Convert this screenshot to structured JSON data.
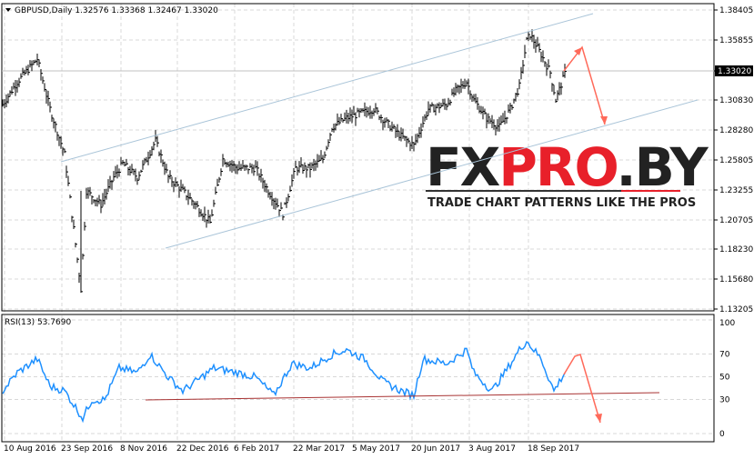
{
  "header": {
    "symbol": "GBPUSD,Daily",
    "open": "1.32576",
    "high": "1.33368",
    "low": "1.32467",
    "close": "1.33020"
  },
  "rsi_header": {
    "label": "RSI(13) 53.7690"
  },
  "current_price": "1.33020",
  "logo": {
    "brand": "FXPRO.BY",
    "tagline": "TRADE CHART PATTERNS LIKE THE PROS"
  },
  "colors": {
    "bars": "#000000",
    "rsi": "#1e90ff",
    "channel": "#a9c4d8",
    "rsi_trend": "#a83232",
    "arrows": "#ff6a5a"
  },
  "chart_data": [
    {
      "type": "line",
      "title": "GBPUSD,Daily",
      "ylim": [
        1.13205,
        1.38405
      ],
      "y_ticks": [
        "1.38405",
        "1.35855",
        "1.33020",
        "1.30830",
        "1.28280",
        "1.25805",
        "1.23255",
        "1.20705",
        "1.18230",
        "1.15680",
        "1.13205"
      ],
      "x_ticks": [
        "10 Aug 2016",
        "23 Sep 2016",
        "8 Nov 2016",
        "22 Dec 2016",
        "6 Feb 2017",
        "22 Mar 2017",
        "5 May 2017",
        "20 Jun 2017",
        "3 Aug 2017",
        "18 Sep 2017"
      ],
      "anchors_bar_price": [
        [
          0,
          1.3044
        ],
        [
          8,
          1.3235
        ],
        [
          19,
          1.3427
        ],
        [
          26,
          1.3006
        ],
        [
          34,
          1.2623
        ],
        [
          43,
          1.1489
        ],
        [
          46,
          1.2316
        ],
        [
          54,
          1.2201
        ],
        [
          61,
          1.2431
        ],
        [
          66,
          1.2546
        ],
        [
          74,
          1.2431
        ],
        [
          84,
          1.2738
        ],
        [
          91,
          1.2431
        ],
        [
          99,
          1.2316
        ],
        [
          106,
          1.2201
        ],
        [
          114,
          1.2048
        ],
        [
          121,
          1.2584
        ],
        [
          129,
          1.2508
        ],
        [
          139,
          1.2508
        ],
        [
          146,
          1.2316
        ],
        [
          154,
          1.2125
        ],
        [
          161,
          1.2508
        ],
        [
          169,
          1.2508
        ],
        [
          176,
          1.2584
        ],
        [
          181,
          1.2852
        ],
        [
          189,
          1.2929
        ],
        [
          196,
          1.2967
        ],
        [
          204,
          1.3006
        ],
        [
          211,
          1.289
        ],
        [
          219,
          1.2776
        ],
        [
          226,
          1.2699
        ],
        [
          234,
          1.3006
        ],
        [
          244,
          1.3044
        ],
        [
          249,
          1.3159
        ],
        [
          255,
          1.3235
        ],
        [
          259,
          1.3082
        ],
        [
          266,
          1.2929
        ],
        [
          273,
          1.2852
        ],
        [
          279,
          1.3006
        ],
        [
          284,
          1.3197
        ],
        [
          288,
          1.358
        ],
        [
          290,
          1.3634
        ],
        [
          296,
          1.3465
        ],
        [
          301,
          1.3312
        ],
        [
          304,
          1.3082
        ],
        [
          309,
          1.3302
        ]
      ]
    },
    {
      "type": "line",
      "title": "RSI(13) 53.7690",
      "ylim": [
        0,
        100
      ],
      "y_ticks": [
        "100",
        "70",
        "50",
        "30",
        "0"
      ],
      "anchors_bar_value": [
        [
          0,
          37.6
        ],
        [
          8,
          53.6
        ],
        [
          19,
          65.6
        ],
        [
          26,
          41.6
        ],
        [
          34,
          37.6
        ],
        [
          44,
          13.6
        ],
        [
          49,
          29.6
        ],
        [
          56,
          29.6
        ],
        [
          64,
          57.6
        ],
        [
          74,
          53.6
        ],
        [
          81,
          69.6
        ],
        [
          91,
          49.6
        ],
        [
          99,
          37.6
        ],
        [
          106,
          45.6
        ],
        [
          116,
          57.6
        ],
        [
          129,
          53.6
        ],
        [
          139,
          49.6
        ],
        [
          149,
          33.6
        ],
        [
          159,
          61.6
        ],
        [
          169,
          57.6
        ],
        [
          181,
          69.6
        ],
        [
          189,
          73.6
        ],
        [
          199,
          65.6
        ],
        [
          209,
          45.6
        ],
        [
          219,
          37.6
        ],
        [
          226,
          33.6
        ],
        [
          231,
          65.6
        ],
        [
          244,
          61.6
        ],
        [
          255,
          73.6
        ],
        [
          259,
          53.6
        ],
        [
          269,
          37.6
        ],
        [
          276,
          53.6
        ],
        [
          284,
          73.6
        ],
        [
          288,
          81.6
        ],
        [
          296,
          65.6
        ],
        [
          303,
          37.6
        ],
        [
          309,
          53.8
        ]
      ]
    }
  ]
}
